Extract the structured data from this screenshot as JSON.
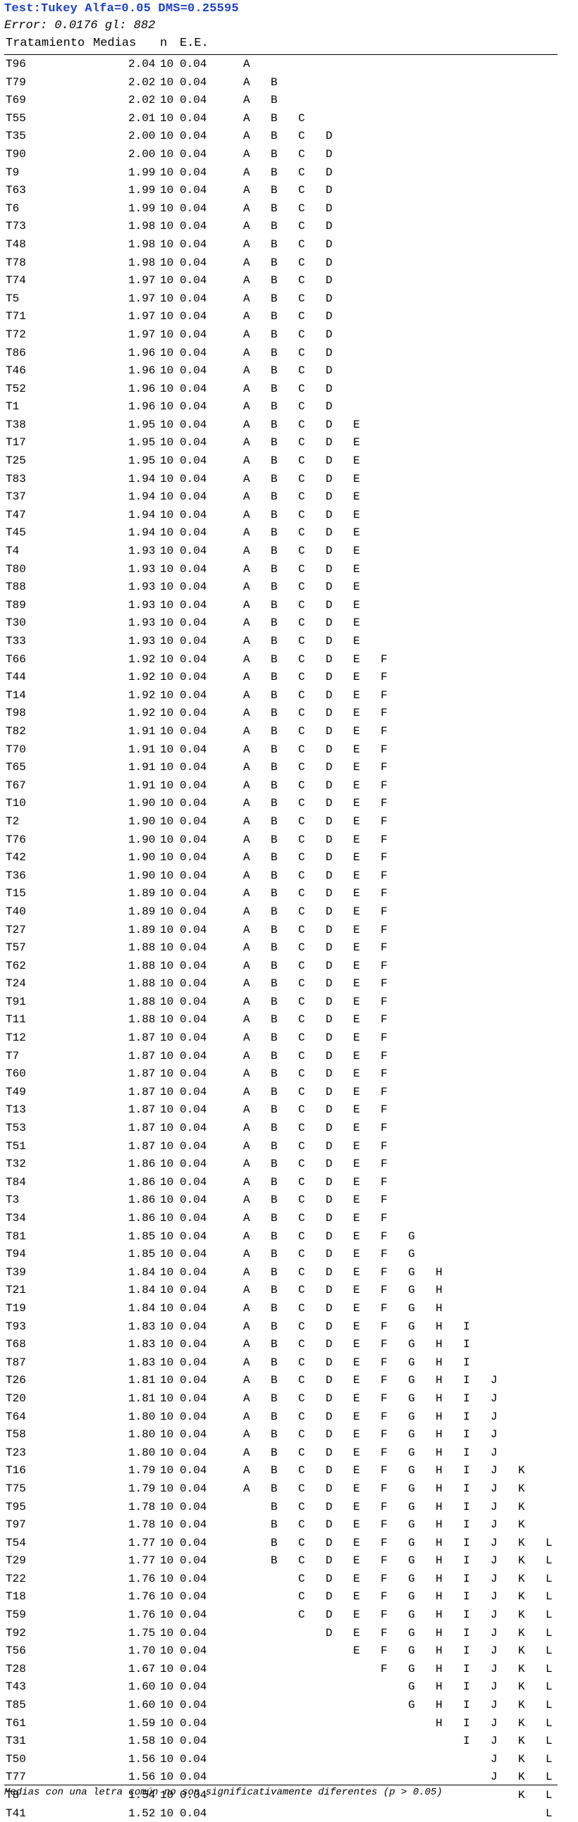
{
  "header": {
    "title": "Test:Tukey Alfa=0.05 DMS=0.25595",
    "error_line": "Error: 0.0176 gl: 882",
    "title_color": "#1e40c8"
  },
  "columns": {
    "tratamiento": "Tratamiento",
    "medias": "Medias",
    "n": "n",
    "ee": "E.E."
  },
  "rows": [
    {
      "t": "T96",
      "m": "2.04",
      "n": "10",
      "e": "0.04",
      "g": "A"
    },
    {
      "t": "T79",
      "m": "2.02",
      "n": "10",
      "e": "0.04",
      "g": "AB"
    },
    {
      "t": "T69",
      "m": "2.02",
      "n": "10",
      "e": "0.04",
      "g": "AB"
    },
    {
      "t": "T55",
      "m": "2.01",
      "n": "10",
      "e": "0.04",
      "g": "ABC"
    },
    {
      "t": "T35",
      "m": "2.00",
      "n": "10",
      "e": "0.04",
      "g": "ABCD"
    },
    {
      "t": "T90",
      "m": "2.00",
      "n": "10",
      "e": "0.04",
      "g": "ABCD"
    },
    {
      "t": "T9",
      "m": "1.99",
      "n": "10",
      "e": "0.04",
      "g": "ABCD"
    },
    {
      "t": "T63",
      "m": "1.99",
      "n": "10",
      "e": "0.04",
      "g": "ABCD"
    },
    {
      "t": "T6",
      "m": "1.99",
      "n": "10",
      "e": "0.04",
      "g": "ABCD"
    },
    {
      "t": "T73",
      "m": "1.98",
      "n": "10",
      "e": "0.04",
      "g": "ABCD"
    },
    {
      "t": "T48",
      "m": "1.98",
      "n": "10",
      "e": "0.04",
      "g": "ABCD"
    },
    {
      "t": "T78",
      "m": "1.98",
      "n": "10",
      "e": "0.04",
      "g": "ABCD"
    },
    {
      "t": "T74",
      "m": "1.97",
      "n": "10",
      "e": "0.04",
      "g": "ABCD"
    },
    {
      "t": "T5",
      "m": "1.97",
      "n": "10",
      "e": "0.04",
      "g": "ABCD"
    },
    {
      "t": "T71",
      "m": "1.97",
      "n": "10",
      "e": "0.04",
      "g": "ABCD"
    },
    {
      "t": "T72",
      "m": "1.97",
      "n": "10",
      "e": "0.04",
      "g": "ABCD"
    },
    {
      "t": "T86",
      "m": "1.96",
      "n": "10",
      "e": "0.04",
      "g": "ABCD"
    },
    {
      "t": "T46",
      "m": "1.96",
      "n": "10",
      "e": "0.04",
      "g": "ABCD"
    },
    {
      "t": "T52",
      "m": "1.96",
      "n": "10",
      "e": "0.04",
      "g": "ABCD"
    },
    {
      "t": "T1",
      "m": "1.96",
      "n": "10",
      "e": "0.04",
      "g": "ABCD"
    },
    {
      "t": "T38",
      "m": "1.95",
      "n": "10",
      "e": "0.04",
      "g": "ABCDE"
    },
    {
      "t": "T17",
      "m": "1.95",
      "n": "10",
      "e": "0.04",
      "g": "ABCDE"
    },
    {
      "t": "T25",
      "m": "1.95",
      "n": "10",
      "e": "0.04",
      "g": "ABCDE"
    },
    {
      "t": "T83",
      "m": "1.94",
      "n": "10",
      "e": "0.04",
      "g": "ABCDE"
    },
    {
      "t": "T37",
      "m": "1.94",
      "n": "10",
      "e": "0.04",
      "g": "ABCDE"
    },
    {
      "t": "T47",
      "m": "1.94",
      "n": "10",
      "e": "0.04",
      "g": "ABCDE"
    },
    {
      "t": "T45",
      "m": "1.94",
      "n": "10",
      "e": "0.04",
      "g": "ABCDE"
    },
    {
      "t": "T4",
      "m": "1.93",
      "n": "10",
      "e": "0.04",
      "g": "ABCDE"
    },
    {
      "t": "T80",
      "m": "1.93",
      "n": "10",
      "e": "0.04",
      "g": "ABCDE"
    },
    {
      "t": "T88",
      "m": "1.93",
      "n": "10",
      "e": "0.04",
      "g": "ABCDE"
    },
    {
      "t": "T89",
      "m": "1.93",
      "n": "10",
      "e": "0.04",
      "g": "ABCDE"
    },
    {
      "t": "T30",
      "m": "1.93",
      "n": "10",
      "e": "0.04",
      "g": "ABCDE"
    },
    {
      "t": "T33",
      "m": "1.93",
      "n": "10",
      "e": "0.04",
      "g": "ABCDE"
    },
    {
      "t": "T66",
      "m": "1.92",
      "n": "10",
      "e": "0.04",
      "g": "ABCDEF"
    },
    {
      "t": "T44",
      "m": "1.92",
      "n": "10",
      "e": "0.04",
      "g": "ABCDEF"
    },
    {
      "t": "T14",
      "m": "1.92",
      "n": "10",
      "e": "0.04",
      "g": "ABCDEF"
    },
    {
      "t": "T98",
      "m": "1.92",
      "n": "10",
      "e": "0.04",
      "g": "ABCDEF"
    },
    {
      "t": "T82",
      "m": "1.91",
      "n": "10",
      "e": "0.04",
      "g": "ABCDEF"
    },
    {
      "t": "T70",
      "m": "1.91",
      "n": "10",
      "e": "0.04",
      "g": "ABCDEF"
    },
    {
      "t": "T65",
      "m": "1.91",
      "n": "10",
      "e": "0.04",
      "g": "ABCDEF"
    },
    {
      "t": "T67",
      "m": "1.91",
      "n": "10",
      "e": "0.04",
      "g": "ABCDEF"
    },
    {
      "t": "T10",
      "m": "1.90",
      "n": "10",
      "e": "0.04",
      "g": "ABCDEF"
    },
    {
      "t": "T2",
      "m": "1.90",
      "n": "10",
      "e": "0.04",
      "g": "ABCDEF"
    },
    {
      "t": "T76",
      "m": "1.90",
      "n": "10",
      "e": "0.04",
      "g": "ABCDEF"
    },
    {
      "t": "T42",
      "m": "1.90",
      "n": "10",
      "e": "0.04",
      "g": "ABCDEF"
    },
    {
      "t": "T36",
      "m": "1.90",
      "n": "10",
      "e": "0.04",
      "g": "ABCDEF"
    },
    {
      "t": "T15",
      "m": "1.89",
      "n": "10",
      "e": "0.04",
      "g": "ABCDEF"
    },
    {
      "t": "T40",
      "m": "1.89",
      "n": "10",
      "e": "0.04",
      "g": "ABCDEF"
    },
    {
      "t": "T27",
      "m": "1.89",
      "n": "10",
      "e": "0.04",
      "g": "ABCDEF"
    },
    {
      "t": "T57",
      "m": "1.88",
      "n": "10",
      "e": "0.04",
      "g": "ABCDEF"
    },
    {
      "t": "T62",
      "m": "1.88",
      "n": "10",
      "e": "0.04",
      "g": "ABCDEF"
    },
    {
      "t": "T24",
      "m": "1.88",
      "n": "10",
      "e": "0.04",
      "g": "ABCDEF"
    },
    {
      "t": "T91",
      "m": "1.88",
      "n": "10",
      "e": "0.04",
      "g": "ABCDEF"
    },
    {
      "t": "T11",
      "m": "1.88",
      "n": "10",
      "e": "0.04",
      "g": "ABCDEF"
    },
    {
      "t": "T12",
      "m": "1.87",
      "n": "10",
      "e": "0.04",
      "g": "ABCDEF"
    },
    {
      "t": "T7",
      "m": "1.87",
      "n": "10",
      "e": "0.04",
      "g": "ABCDEF"
    },
    {
      "t": "T60",
      "m": "1.87",
      "n": "10",
      "e": "0.04",
      "g": "ABCDEF"
    },
    {
      "t": "T49",
      "m": "1.87",
      "n": "10",
      "e": "0.04",
      "g": "ABCDEF"
    },
    {
      "t": "T13",
      "m": "1.87",
      "n": "10",
      "e": "0.04",
      "g": "ABCDEF"
    },
    {
      "t": "T53",
      "m": "1.87",
      "n": "10",
      "e": "0.04",
      "g": "ABCDEF"
    },
    {
      "t": "T51",
      "m": "1.87",
      "n": "10",
      "e": "0.04",
      "g": "ABCDEF"
    },
    {
      "t": "T32",
      "m": "1.86",
      "n": "10",
      "e": "0.04",
      "g": "ABCDEF"
    },
    {
      "t": "T84",
      "m": "1.86",
      "n": "10",
      "e": "0.04",
      "g": "ABCDEF"
    },
    {
      "t": "T3",
      "m": "1.86",
      "n": "10",
      "e": "0.04",
      "g": "ABCDEF"
    },
    {
      "t": "T34",
      "m": "1.86",
      "n": "10",
      "e": "0.04",
      "g": "ABCDEF"
    },
    {
      "t": "T81",
      "m": "1.85",
      "n": "10",
      "e": "0.04",
      "g": "ABCDEFG"
    },
    {
      "t": "T94",
      "m": "1.85",
      "n": "10",
      "e": "0.04",
      "g": "ABCDEFG"
    },
    {
      "t": "T39",
      "m": "1.84",
      "n": "10",
      "e": "0.04",
      "g": "ABCDEFGH"
    },
    {
      "t": "T21",
      "m": "1.84",
      "n": "10",
      "e": "0.04",
      "g": "ABCDEFGH"
    },
    {
      "t": "T19",
      "m": "1.84",
      "n": "10",
      "e": "0.04",
      "g": "ABCDEFGH"
    },
    {
      "t": "T93",
      "m": "1.83",
      "n": "10",
      "e": "0.04",
      "g": "ABCDEFGHI"
    },
    {
      "t": "T68",
      "m": "1.83",
      "n": "10",
      "e": "0.04",
      "g": "ABCDEFGHI"
    },
    {
      "t": "T87",
      "m": "1.83",
      "n": "10",
      "e": "0.04",
      "g": "ABCDEFGHI"
    },
    {
      "t": "T26",
      "m": "1.81",
      "n": "10",
      "e": "0.04",
      "g": "ABCDEFGHIJ"
    },
    {
      "t": "T20",
      "m": "1.81",
      "n": "10",
      "e": "0.04",
      "g": "ABCDEFGHIJ"
    },
    {
      "t": "T64",
      "m": "1.80",
      "n": "10",
      "e": "0.04",
      "g": "ABCDEFGHIJ"
    },
    {
      "t": "T58",
      "m": "1.80",
      "n": "10",
      "e": "0.04",
      "g": "ABCDEFGHIJ"
    },
    {
      "t": "T23",
      "m": "1.80",
      "n": "10",
      "e": "0.04",
      "g": "ABCDEFGHIJ"
    },
    {
      "t": "T16",
      "m": "1.79",
      "n": "10",
      "e": "0.04",
      "g": "ABCDEFGHIJK"
    },
    {
      "t": "T75",
      "m": "1.79",
      "n": "10",
      "e": "0.04",
      "g": "ABCDEFGHIJK"
    },
    {
      "t": "T95",
      "m": "1.78",
      "n": "10",
      "e": "0.04",
      "g": "BCDEFGHIJK"
    },
    {
      "t": "T97",
      "m": "1.78",
      "n": "10",
      "e": "0.04",
      "g": "BCDEFGHIJK"
    },
    {
      "t": "T54",
      "m": "1.77",
      "n": "10",
      "e": "0.04",
      "g": "BCDEFGHIJKL"
    },
    {
      "t": "T29",
      "m": "1.77",
      "n": "10",
      "e": "0.04",
      "g": "BCDEFGHIJKL"
    },
    {
      "t": "T22",
      "m": "1.76",
      "n": "10",
      "e": "0.04",
      "g": "CDEFGHIJKL"
    },
    {
      "t": "T18",
      "m": "1.76",
      "n": "10",
      "e": "0.04",
      "g": "CDEFGHIJKL"
    },
    {
      "t": "T59",
      "m": "1.76",
      "n": "10",
      "e": "0.04",
      "g": "CDEFGHIJKL"
    },
    {
      "t": "T92",
      "m": "1.75",
      "n": "10",
      "e": "0.04",
      "g": "DEFGHIJKL"
    },
    {
      "t": "T56",
      "m": "1.70",
      "n": "10",
      "e": "0.04",
      "g": "EFGHIJKL"
    },
    {
      "t": "T28",
      "m": "1.67",
      "n": "10",
      "e": "0.04",
      "g": "FGHIJKL"
    },
    {
      "t": "T43",
      "m": "1.60",
      "n": "10",
      "e": "0.04",
      "g": "GHIJKL"
    },
    {
      "t": "T85",
      "m": "1.60",
      "n": "10",
      "e": "0.04",
      "g": "GHIJKL"
    },
    {
      "t": "T61",
      "m": "1.59",
      "n": "10",
      "e": "0.04",
      "g": "HIJKL"
    },
    {
      "t": "T31",
      "m": "1.58",
      "n": "10",
      "e": "0.04",
      "g": "IJKL"
    },
    {
      "t": "T50",
      "m": "1.56",
      "n": "10",
      "e": "0.04",
      "g": "JKL"
    },
    {
      "t": "T77",
      "m": "1.56",
      "n": "10",
      "e": "0.04",
      "g": "JKL"
    },
    {
      "t": "T8",
      "m": "1.54",
      "n": "10",
      "e": "0.04",
      "g": "KL"
    },
    {
      "t": "T41",
      "m": "1.52",
      "n": "10",
      "e": "0.04",
      "g": "L"
    }
  ],
  "footnote": "Medias con una letra común no son significativamente diferentes (p > 0.05)"
}
